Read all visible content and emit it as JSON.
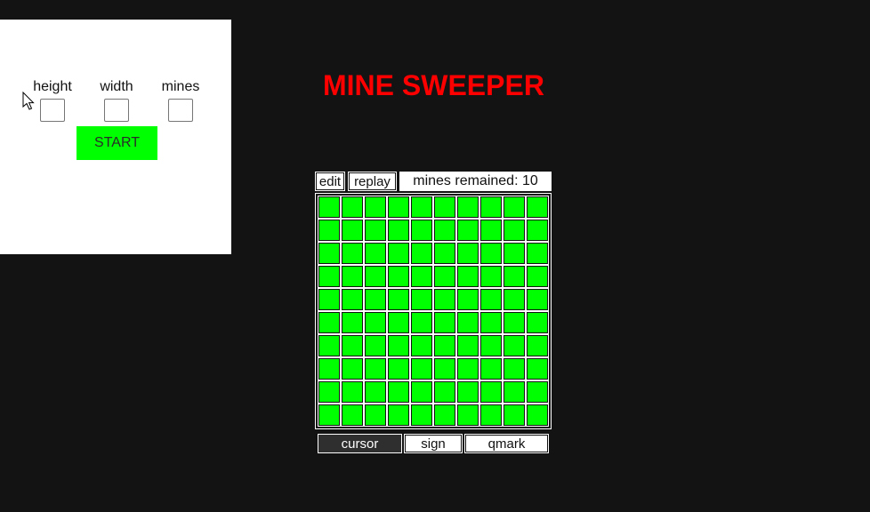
{
  "settings": {
    "height_label": "height",
    "width_label": "width",
    "mines_label": "mines",
    "height_value": "",
    "width_value": "",
    "mines_value": "",
    "start_label": "START"
  },
  "title": "MINE SWEEPER",
  "controls": {
    "edit_label": "edit",
    "replay_label": "replay",
    "mines_remained_text": "mines remained: 10"
  },
  "board": {
    "rows": 10,
    "cols": 10,
    "cell_color": "#00ff00"
  },
  "tools": {
    "cursor_label": "cursor",
    "sign_label": "sign",
    "qmark_label": "qmark",
    "active": "cursor"
  },
  "colors": {
    "title": "#ff0000",
    "accent": "#00ff00",
    "background": "#131313"
  }
}
